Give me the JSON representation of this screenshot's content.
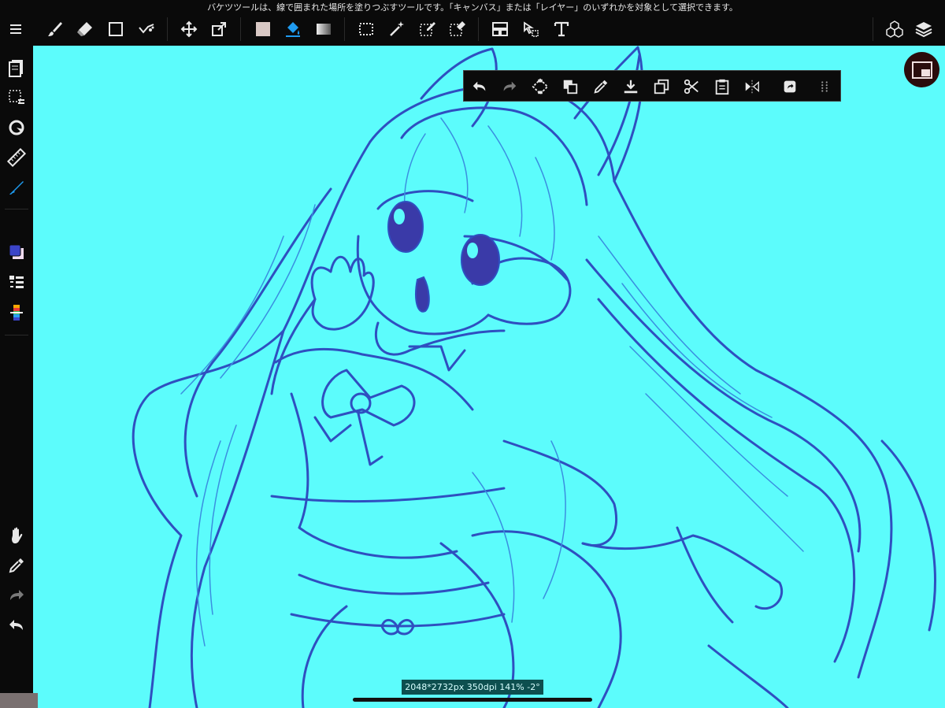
{
  "hint_text": "バケツツールは、線で囲まれた場所を塗りつぶすツールです。「キャンバス」または「レイヤー」のいずれかを対象として選択できます。",
  "status_text": "2048*2732px 350dpi 141% -2°",
  "colors": {
    "bar_bg": "#0a0a0a",
    "canvas_bg": "#5cfcfc",
    "line_art": "#2f4fc0",
    "line_art_thin": "#3a8fe0",
    "eye_fill": "#3a3aa8",
    "active_tool": "#1f9bf0",
    "main_color": "#3b44c8",
    "sub_color": "#f2dcf0",
    "status_bg": "#0d4f4f"
  },
  "top_toolbar": {
    "left_tools": [
      "menu-icon",
      "brush-icon",
      "eraser-icon",
      "shape-icon",
      "blur-icon",
      "move-icon",
      "transform-icon",
      "fill-color-icon",
      "bucket-icon",
      "gradient-icon",
      "select-rect-icon",
      "magic-wand-icon",
      "select-pen-icon",
      "select-eraser-icon",
      "frame-icon",
      "select-layer-icon",
      "text-icon"
    ],
    "active_tool": "bucket-icon",
    "right_tools": [
      "materials-icon",
      "layers-icon"
    ]
  },
  "left_toolbar": {
    "top_tools": [
      "pages-icon",
      "selection-menu-icon",
      "snap-icon",
      "ruler-icon",
      "pen-icon"
    ],
    "color_tools": [
      "color-swatch",
      "brush-list-icon",
      "color-palette-icon"
    ],
    "bottom_tools": [
      "hand-icon",
      "eyedropper-icon",
      "redo-icon",
      "undo-icon"
    ]
  },
  "floating_toolbar": {
    "items": [
      "undo-icon",
      "redo-icon",
      "transform-selection-icon",
      "fill-icon",
      "eyedropper-icon",
      "save-icon",
      "copy-icon",
      "cut-icon",
      "paste-icon",
      "flip-icon",
      "quick-share-icon",
      "more-icon"
    ]
  }
}
